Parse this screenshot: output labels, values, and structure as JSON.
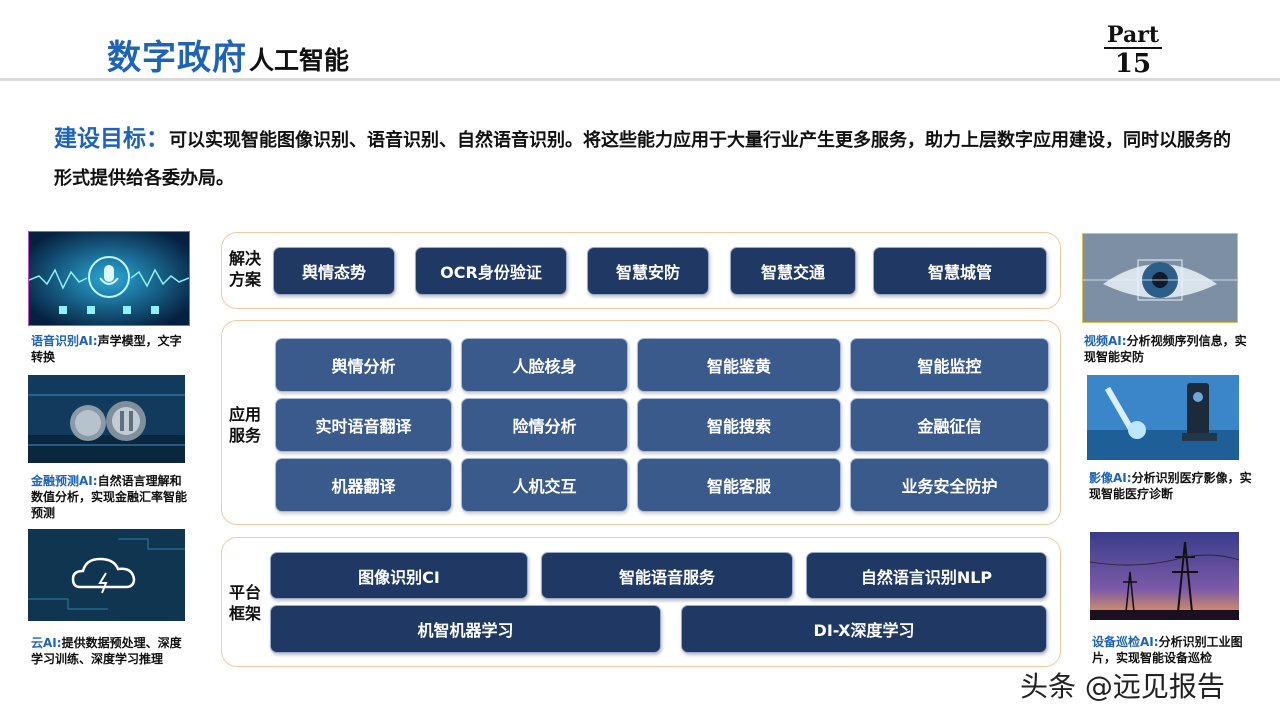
{
  "header": {
    "title_main": "数字政府",
    "title_sub": "人工智能",
    "part_word": "Part",
    "part_number": "15"
  },
  "goal": {
    "label": "建设目标：",
    "text": "可以实现智能图像识别、语音识别、自然语音识别。将这些能力应用于大量行业产生更多服务，助力上层数字应用建设，同时以服务的形式提供给各委办局。"
  },
  "solutions": {
    "label": "解决方案",
    "items": [
      "舆情态势",
      "OCR身份验证",
      "智慧安防",
      "智慧交通",
      "智慧城管"
    ]
  },
  "services": {
    "label": "应用服务",
    "rows": [
      [
        "舆情分析",
        "人脸核身",
        "智能鉴黄",
        "智能监控"
      ],
      [
        "实时语音翻译",
        "险情分析",
        "智能搜索",
        "金融征信"
      ],
      [
        "机器翻译",
        "人机交互",
        "智能客服",
        "业务安全防护"
      ]
    ]
  },
  "platform": {
    "label": "平台框架",
    "row1": [
      "图像识别CI",
      "智能语音服务",
      "自然语言识别NLP"
    ],
    "row2": [
      "机智机器学习",
      "DI-X深度学习"
    ]
  },
  "left_cards": [
    {
      "title": "语音识别AI:",
      "text": "声学模型，文字转换"
    },
    {
      "title": "金融预测AI:",
      "text": "自然语言理解和数值分析，实现金融汇率智能预测"
    },
    {
      "title": "云AI:",
      "text": "提供数据预处理、深度学习训练、深度学习推理"
    }
  ],
  "right_cards": [
    {
      "title": "视频AI:",
      "text": "分析视频序列信息，实现智能安防"
    },
    {
      "title": "影像AI:",
      "text": "分析识别医疗影像，实现智能医疗诊断"
    },
    {
      "title": "设备巡检AI:",
      "text": "分析识别工业图片，实现智能设备巡检"
    }
  ],
  "watermark": "头条 @远见报告",
  "colors": {
    "accent_blue": "#1e63b6",
    "box_dark": "#1f3864",
    "box_mid": "#3b5a8c",
    "panel_border": "#f4c9a2"
  }
}
